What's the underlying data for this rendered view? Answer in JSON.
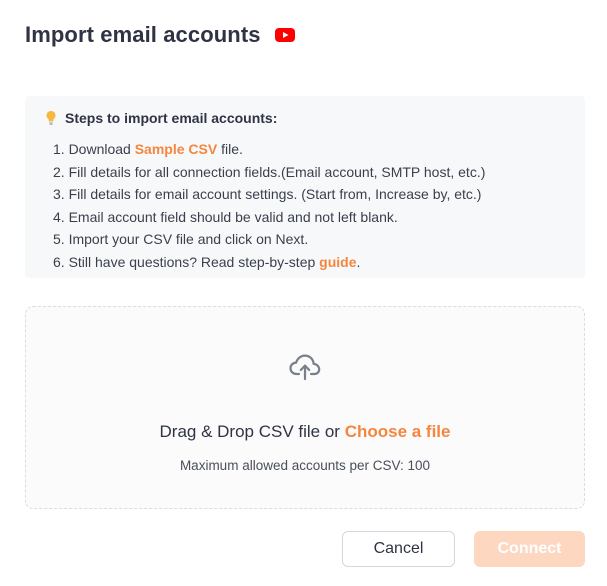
{
  "header": {
    "title": "Import email accounts",
    "video_icon": "youtube-icon"
  },
  "steps": {
    "title": "Steps to import email accounts:",
    "icon": "lightbulb-icon",
    "items": [
      {
        "prefix": "1. Download ",
        "link": "Sample CSV",
        "suffix": " file."
      },
      {
        "text": "2. Fill details for all connection fields.(Email account, SMTP host, etc.)"
      },
      {
        "text": "3. Fill details for email account settings. (Start from, Increase by, etc.)"
      },
      {
        "text": "4. Email account field should be valid and not left blank."
      },
      {
        "text": "5. Import your CSV file and click on Next."
      },
      {
        "prefix": "6. Still have questions? Read step-by-step ",
        "link": "guide",
        "suffix": "."
      }
    ]
  },
  "dropzone": {
    "icon": "cloud-upload-icon",
    "text": "Drag & Drop CSV file or ",
    "choose_link": "Choose a file",
    "max_text": "Maximum allowed accounts per CSV: 100"
  },
  "footer": {
    "cancel_label": "Cancel",
    "connect_label": "Connect"
  },
  "colors": {
    "accent": "#f5863d",
    "connect_disabled": "#fdd7bf",
    "youtube_red": "#ff0000"
  }
}
